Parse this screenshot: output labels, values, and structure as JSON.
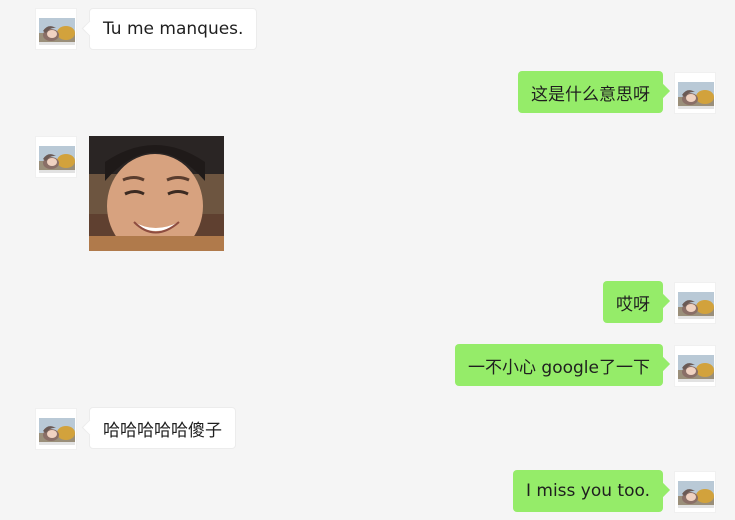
{
  "colors": {
    "background": "#f5f5f5",
    "incoming_bubble": "#ffffff",
    "outgoing_bubble": "#95ec69",
    "text": "#1f1f1f"
  },
  "messages": [
    {
      "side": "incoming",
      "type": "text",
      "text": "Tu me manques."
    },
    {
      "side": "outgoing",
      "type": "text",
      "text": "这是什么意思呀"
    },
    {
      "side": "incoming",
      "type": "image",
      "icon": "smiling-boy-photo"
    },
    {
      "side": "outgoing",
      "type": "text",
      "text": "哎呀"
    },
    {
      "side": "outgoing",
      "type": "text",
      "text": "一不小心 google了一下"
    },
    {
      "side": "incoming",
      "type": "text",
      "text": "哈哈哈哈哈傻子"
    },
    {
      "side": "outgoing",
      "type": "text",
      "text": "I miss you too."
    }
  ]
}
